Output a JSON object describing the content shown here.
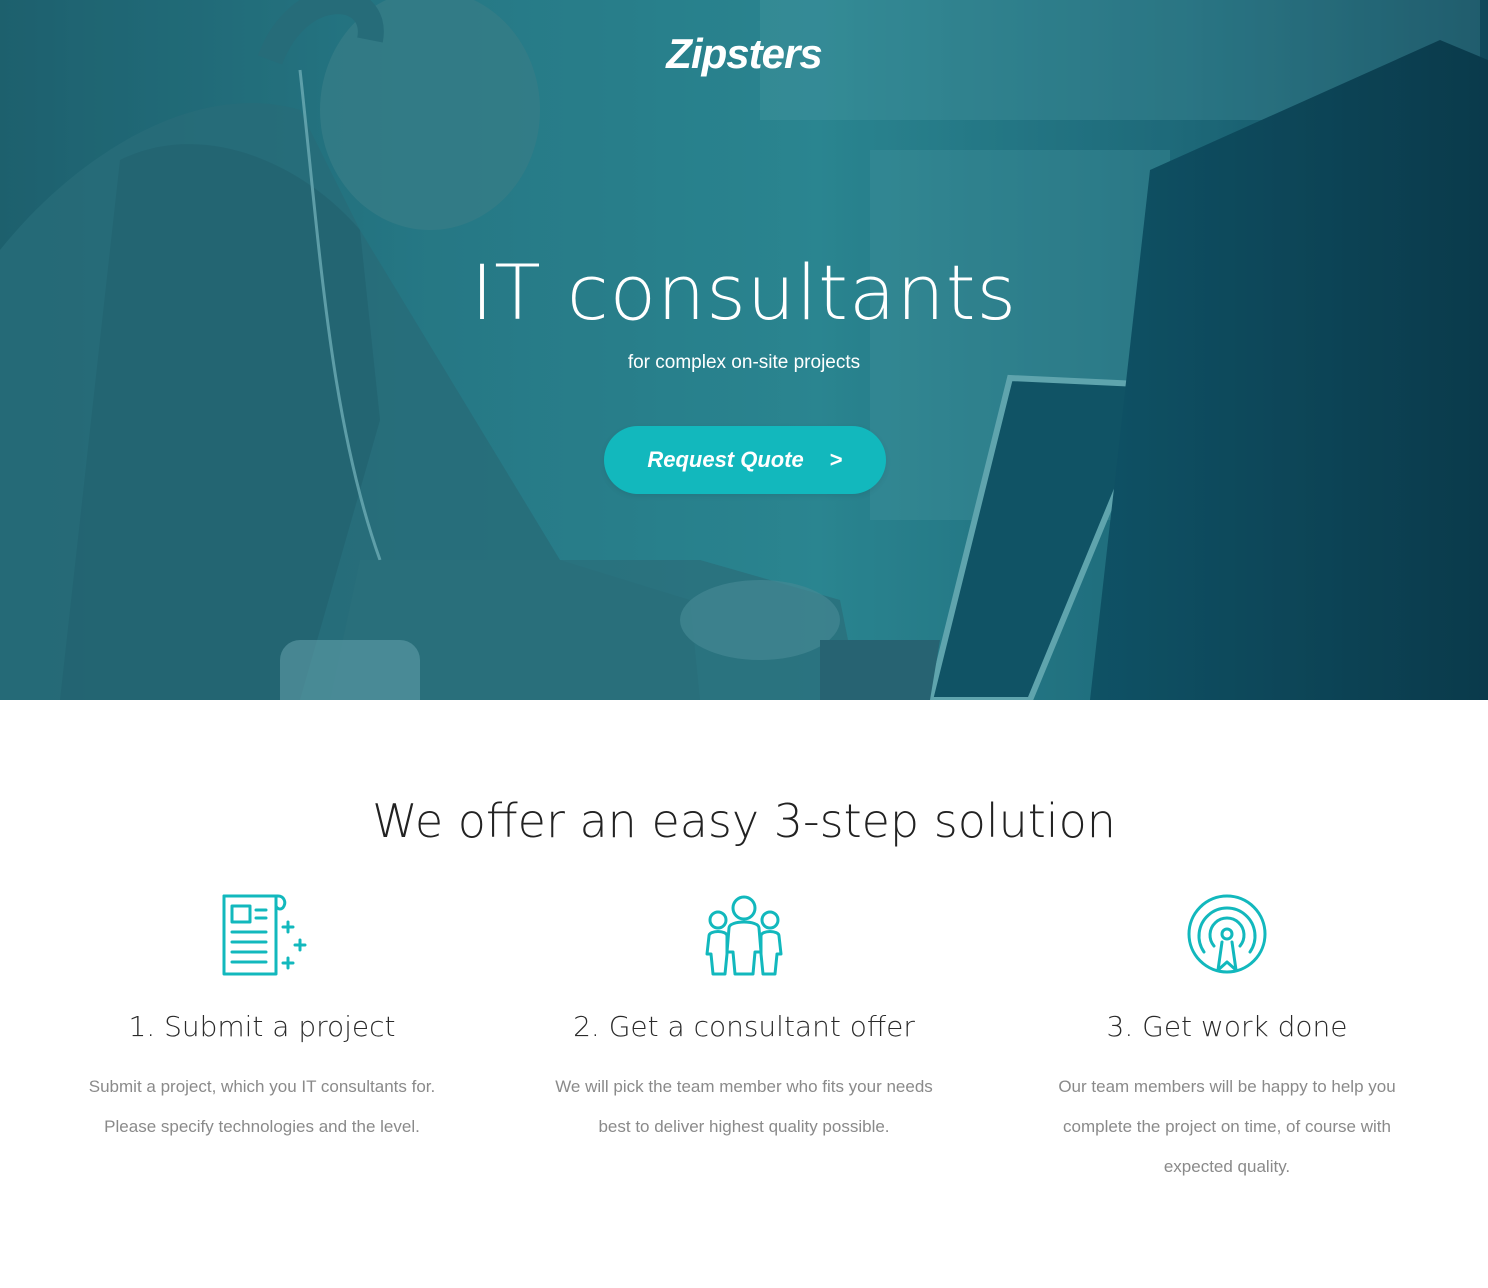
{
  "brand": {
    "name": "Zipsters"
  },
  "hero": {
    "title": "IT consultants",
    "subtitle": "for complex on-site projects",
    "cta_label": "Request Quote",
    "cta_arrow": ">"
  },
  "features": {
    "title": "We offer an easy 3-step solution",
    "steps": [
      {
        "title": "1. Submit a project",
        "line1": "Submit a project, which you IT consultants for.",
        "line2": "Please specify technologies and the level.",
        "line3": ""
      },
      {
        "title": "2. Get a consultant offer",
        "line1": "We will pick the team member who fits your needs",
        "line2": "best to deliver highest quality possible.",
        "line3": ""
      },
      {
        "title": "3. Get work done",
        "line1": "Our team members will be happy to help you",
        "line2": "complete the project on time, of course with",
        "line3": "expected quality."
      }
    ]
  },
  "colors": {
    "accent": "#12b8bd",
    "hero_tint": "#2a7b87"
  },
  "icons": [
    "document-icon",
    "team-icon",
    "target-icon"
  ]
}
